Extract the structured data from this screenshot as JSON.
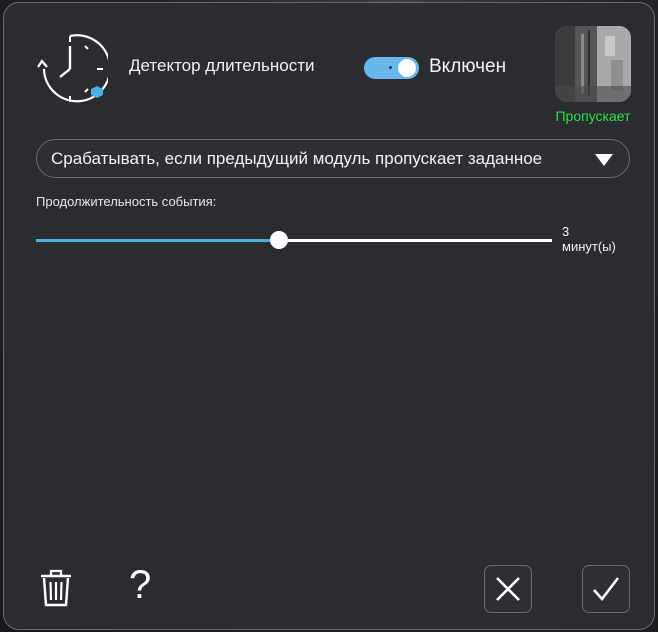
{
  "module": {
    "icon": "clock-duration-icon",
    "title": "Детектор длительности",
    "enabled": true,
    "enabled_label": "Включен"
  },
  "preview": {
    "status": "Пропускает",
    "status_color": "#2ee04b"
  },
  "condition_select": {
    "value": "Срабатывать, если предыдущий модуль пропускает заданное"
  },
  "duration": {
    "label": "Продолжительность события:",
    "value": 3,
    "unit": "минут(ы)",
    "fraction": 0.47,
    "accent_color": "#4ab0e6"
  },
  "footer": {
    "delete_icon": "trash-icon",
    "help_label": "?",
    "cancel_icon": "close-icon",
    "confirm_icon": "check-icon"
  }
}
